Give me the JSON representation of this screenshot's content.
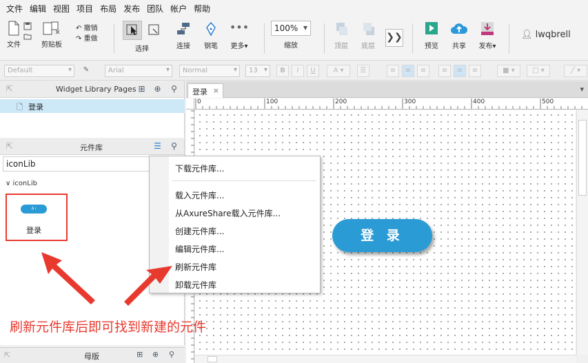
{
  "menu": [
    "文件",
    "编辑",
    "视图",
    "项目",
    "布局",
    "发布",
    "团队",
    "帐户",
    "帮助"
  ],
  "toolbar": {
    "file": "文件",
    "clipboard": "剪贴板",
    "undo": "撤销",
    "redo": "重做",
    "select": "选择",
    "connect": "连接",
    "pen": "钢笔",
    "more": "更多▾",
    "zoom_value": "100%",
    "zoom_label": "缩放",
    "top": "顶层",
    "bottom": "底层",
    "preview": "预览",
    "share": "共享",
    "publish": "发布▾",
    "user": "lwqbrell",
    "colors": {
      "preview": "#2aa68d",
      "share": "#2b98d9",
      "publish": "#c0397e"
    }
  },
  "format": {
    "style": "Default",
    "font": "Arial",
    "weight": "Normal",
    "size": "13"
  },
  "pages_panel": {
    "title": "Widget Library Pages",
    "page": "登录"
  },
  "widgets_panel": {
    "title": "元件库",
    "library": "iconLib",
    "group": "iconLib",
    "widget_label": "登录"
  },
  "masters_panel": {
    "title": "母版"
  },
  "canvas": {
    "tab": "登录",
    "ruler": [
      "0",
      "100",
      "200",
      "300",
      "400",
      "500"
    ],
    "button_text": "登 录",
    "button_color": "#2b9bd6"
  },
  "context_menu": {
    "items": [
      "下载元件库...",
      "载入元件库...",
      "从AxureShare载入元件库...",
      "创建元件库...",
      "编辑元件库...",
      "刷新元件库",
      "卸载元件库"
    ]
  },
  "annotation": {
    "text": "刷新元件库后即可找到新建的元件",
    "color": "#e8392f"
  }
}
